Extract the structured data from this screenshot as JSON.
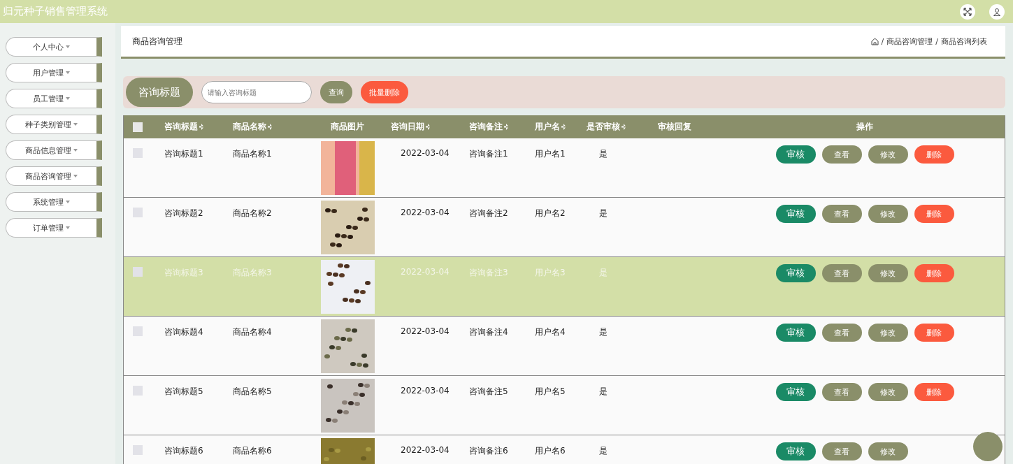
{
  "header": {
    "title": "归元种子销售管理系统"
  },
  "sidebar": {
    "items": [
      {
        "label": "个人中心"
      },
      {
        "label": "用户管理"
      },
      {
        "label": "员工管理"
      },
      {
        "label": "种子类别管理"
      },
      {
        "label": "商品信息管理"
      },
      {
        "label": "商品咨询管理"
      },
      {
        "label": "系统管理"
      },
      {
        "label": "订单管理"
      }
    ]
  },
  "page": {
    "title": "商品咨询管理",
    "breadcrumb": [
      {
        "separator": "/",
        "label": "商品咨询管理"
      },
      {
        "separator": "/",
        "label": "商品咨询列表"
      }
    ]
  },
  "search": {
    "label": "咨询标题",
    "placeholder": "请输入咨询标题",
    "buttons": [
      {
        "label": "查询",
        "kind": "query"
      },
      {
        "label": "批量删除",
        "kind": "danger"
      }
    ]
  },
  "table": {
    "select_all_checked": false,
    "columns": [
      {
        "label": "咨询标题",
        "sortable": true
      },
      {
        "label": "商品名称",
        "sortable": true
      },
      {
        "label": "商品图片",
        "sortable": false
      },
      {
        "label": "咨询日期",
        "sortable": true
      },
      {
        "label": "咨询备注",
        "sortable": true
      },
      {
        "label": "用户名",
        "sortable": true
      },
      {
        "label": "是否审核",
        "sortable": true
      },
      {
        "label": "审核回复",
        "sortable": false
      },
      {
        "label": "操作",
        "sortable": false
      }
    ],
    "rows": [
      {
        "checked": false,
        "title": "咨询标题1",
        "name": "商品名称1",
        "date": "2022-03-04",
        "remark": "咨询备注1",
        "user": "用户名1",
        "audited": "是",
        "highlighted": false,
        "actions": [
          {
            "label": "审核",
            "kind": "audit"
          },
          {
            "label": "查看",
            "kind": "view"
          },
          {
            "label": "修改",
            "kind": "edit"
          },
          {
            "label": "删除",
            "kind": "delete"
          }
        ]
      },
      {
        "checked": false,
        "title": "咨询标题2",
        "name": "商品名称2",
        "date": "2022-03-04",
        "remark": "咨询备注2",
        "user": "用户名2",
        "audited": "是",
        "highlighted": false,
        "actions": [
          {
            "label": "审核",
            "kind": "audit"
          },
          {
            "label": "查看",
            "kind": "view"
          },
          {
            "label": "修改",
            "kind": "edit"
          },
          {
            "label": "删除",
            "kind": "delete"
          }
        ]
      },
      {
        "checked": false,
        "title": "咨询标题3",
        "name": "商品名称3",
        "date": "2022-03-04",
        "remark": "咨询备注3",
        "user": "用户名3",
        "audited": "是",
        "highlighted": true,
        "actions": [
          {
            "label": "审核",
            "kind": "audit"
          },
          {
            "label": "查看",
            "kind": "view"
          },
          {
            "label": "修改",
            "kind": "edit"
          },
          {
            "label": "删除",
            "kind": "delete"
          }
        ]
      },
      {
        "checked": false,
        "title": "咨询标题4",
        "name": "商品名称4",
        "date": "2022-03-04",
        "remark": "咨询备注4",
        "user": "用户名4",
        "audited": "是",
        "highlighted": false,
        "actions": [
          {
            "label": "审核",
            "kind": "audit"
          },
          {
            "label": "查看",
            "kind": "view"
          },
          {
            "label": "修改",
            "kind": "edit"
          },
          {
            "label": "删除",
            "kind": "delete"
          }
        ]
      },
      {
        "checked": false,
        "title": "咨询标题5",
        "name": "商品名称5",
        "date": "2022-03-04",
        "remark": "咨询备注5",
        "user": "用户名5",
        "audited": "是",
        "highlighted": false,
        "actions": [
          {
            "label": "审核",
            "kind": "audit"
          },
          {
            "label": "查看",
            "kind": "view"
          },
          {
            "label": "修改",
            "kind": "edit"
          },
          {
            "label": "删除",
            "kind": "delete"
          }
        ]
      },
      {
        "checked": false,
        "title": "咨询标题6",
        "name": "商品名称6",
        "date": "2022-03-04",
        "remark": "咨询备注6",
        "user": "用户名6",
        "audited": "是",
        "highlighted": false,
        "actions": [
          {
            "label": "审核",
            "kind": "audit"
          },
          {
            "label": "查看",
            "kind": "view"
          },
          {
            "label": "修改",
            "kind": "edit"
          }
        ]
      }
    ]
  }
}
